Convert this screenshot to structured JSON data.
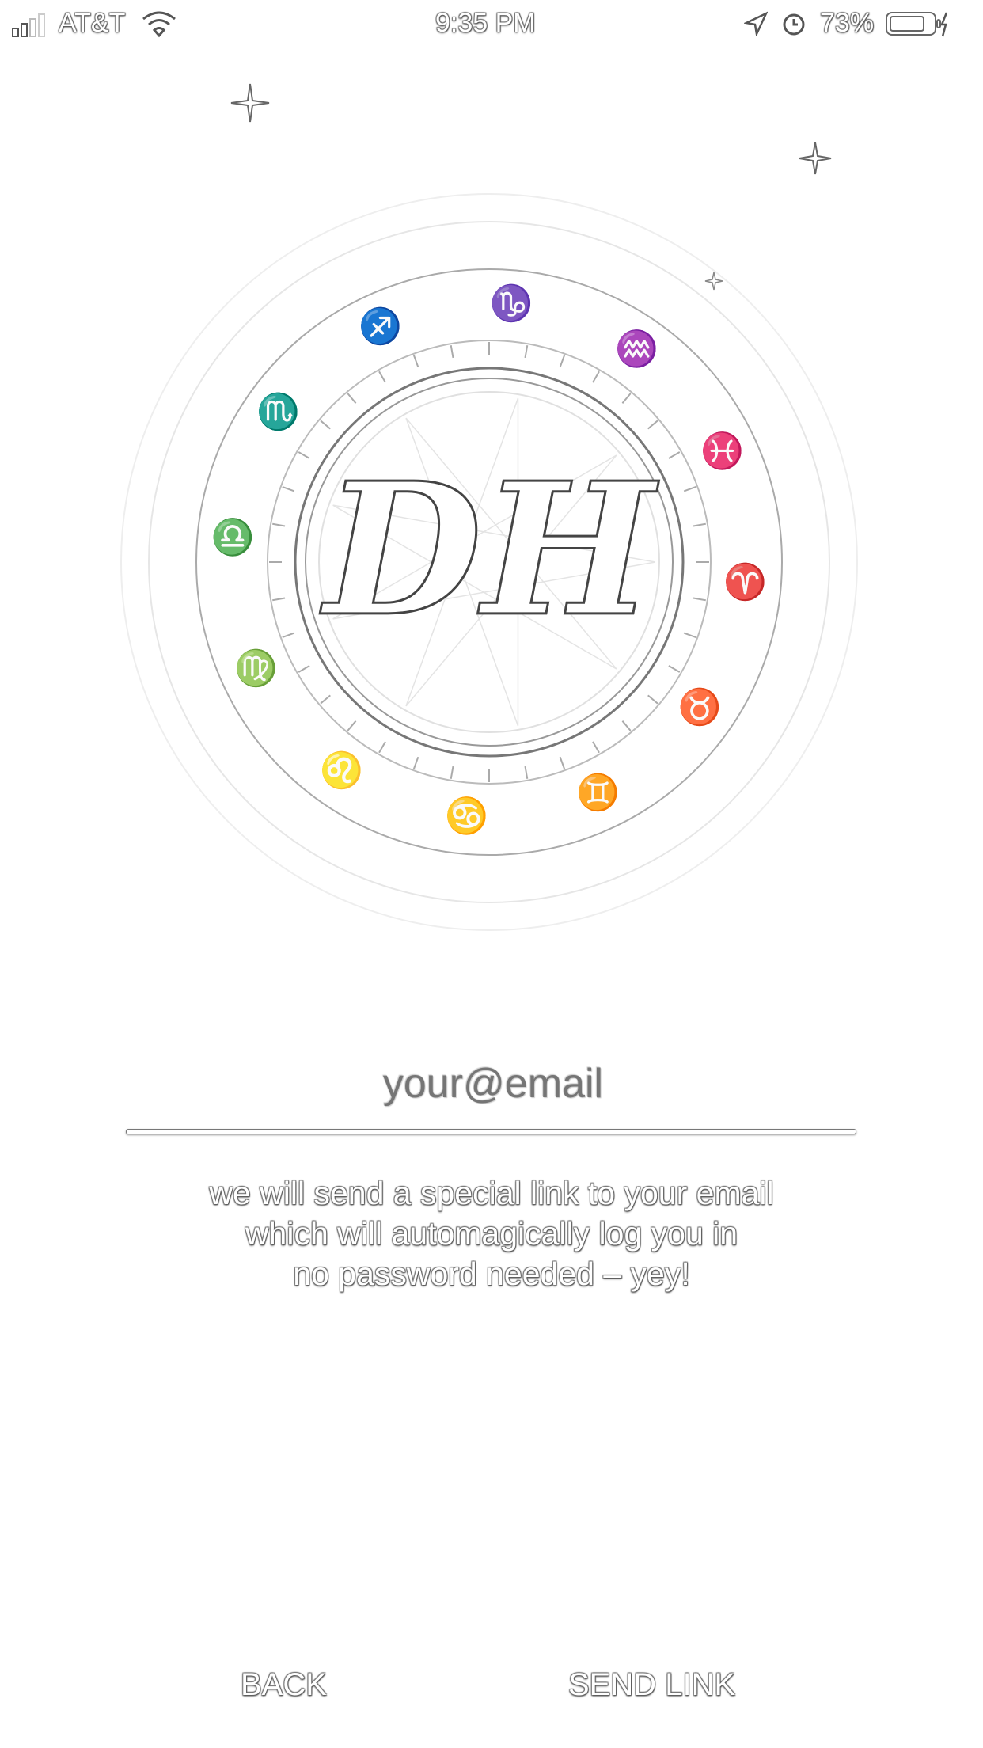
{
  "status_bar": {
    "carrier": "AT&T",
    "time": "9:35 PM",
    "battery": "73%"
  },
  "logo": {
    "monogram": "DH",
    "zodiac": [
      "♐",
      "♑",
      "♒",
      "♓",
      "♈",
      "♉",
      "♊",
      "♋",
      "♌",
      "♍",
      "♎",
      "♏"
    ]
  },
  "email": {
    "placeholder": "your@email",
    "value": ""
  },
  "info": {
    "line1": "we will send a special link to your email",
    "line2": "which will automagically log you in",
    "line3": "no password needed – yey!"
  },
  "buttons": {
    "back": "BACK",
    "send": "SEND LINK"
  }
}
